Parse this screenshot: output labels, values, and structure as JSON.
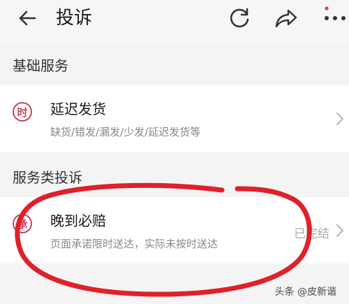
{
  "header": {
    "title": "投诉",
    "back_icon": "back-arrow-icon",
    "refresh_icon": "refresh-icon",
    "share_icon": "share-icon",
    "more_icon": "more-dots-icon"
  },
  "sections": [
    {
      "title": "基础服务",
      "items": [
        {
          "badge": "时",
          "title": "延迟发货",
          "description": "缺货/错发/漏发/少发/延迟发货等",
          "status": ""
        }
      ]
    },
    {
      "title": "服务类投诉",
      "items": [
        {
          "badge": "承",
          "title": "晚到必赔",
          "description": "页面承诺限时送达，实际未按时送达",
          "status": "已完结"
        }
      ]
    }
  ],
  "watermark": "头条 @皮新谐",
  "colors": {
    "accent": "#d0405a",
    "annotation": "#e0202a",
    "background": "#f4f4f4",
    "card": "#ffffff"
  }
}
